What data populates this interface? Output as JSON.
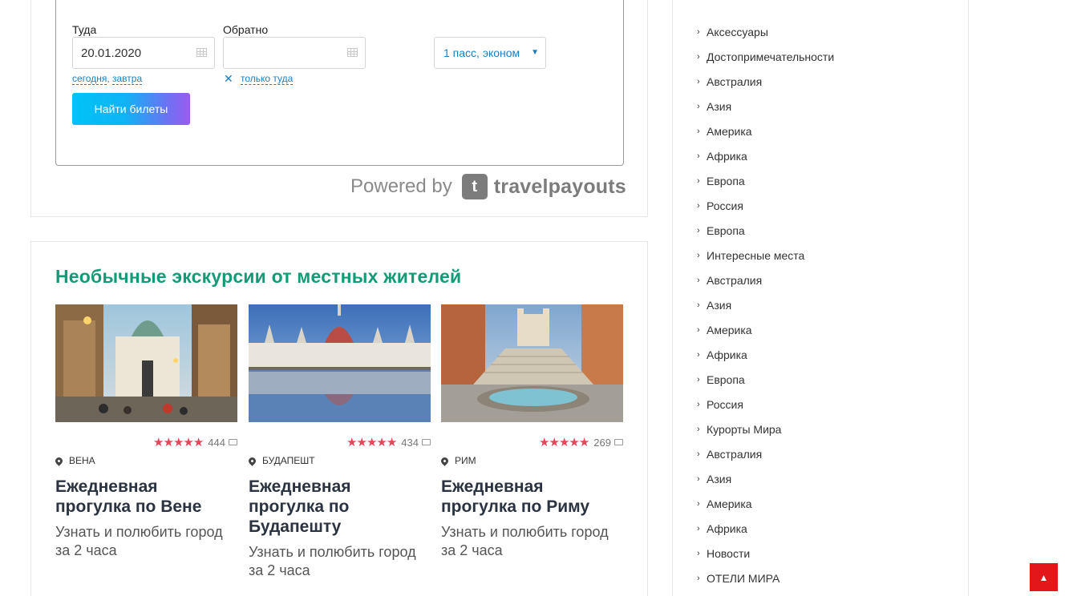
{
  "flight_search": {
    "depart_label": "Туда",
    "depart_value": "20.01.2020",
    "depart_quick_links": [
      "сегодня",
      "завтра"
    ],
    "return_label": "Обратно",
    "return_value": "",
    "return_only_link": "только туда",
    "passengers_value": "1 пасс, эконом",
    "search_button": "Найти билеты",
    "powered_by": "Powered by",
    "brand_mark": "t",
    "brand_name": "travelpayouts"
  },
  "excursions": {
    "title": "Необычные экскурсии от местных жителей",
    "tours": [
      {
        "city": "Вена",
        "reviews": "444",
        "rating": 4.5,
        "name": "Ежедневная прогулка по Вене",
        "description": "Узнать и полюбить город за 2 часа"
      },
      {
        "city": "Будапешт",
        "reviews": "434",
        "rating": 5,
        "name": "Ежедневная прогулка по Будапешту",
        "description": "Узнать и полюбить город за 2 часа"
      },
      {
        "city": "Рим",
        "reviews": "269",
        "rating": 4.5,
        "name": "Ежедневная прогулка по Риму",
        "description": "Узнать и полюбить город за 2 часа"
      }
    ]
  },
  "sidebar": {
    "categories": [
      "Аксессуары",
      "Достопримечательности",
      "Австралия",
      "Азия",
      "Америка",
      "Африка",
      "Европа",
      "Россия",
      "Европа",
      "Интересные места",
      "Австралия",
      "Азия",
      "Америка",
      "Африка",
      "Европа",
      "Россия",
      "Курорты Мира",
      "Австралия",
      "Азия",
      "Америка",
      "Африка",
      "Новости",
      "ОТЕЛИ МИРА"
    ]
  },
  "colors": {
    "accent_green": "#129b76",
    "star_red": "#e8445a",
    "link_blue": "#1b7fbf",
    "to_top_red": "#e3161a"
  },
  "icons": {
    "to_top": "chevron-up-icon",
    "calendar": "calendar-icon",
    "pin": "map-pin-icon",
    "comment": "comment-icon"
  }
}
